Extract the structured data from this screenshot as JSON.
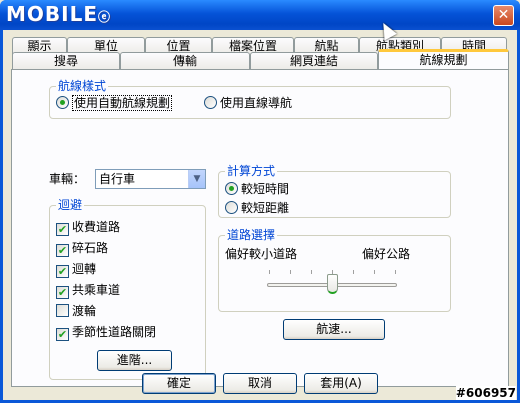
{
  "window": {
    "title_logo": "MOBILE",
    "title_logo_mark": "ⓔ"
  },
  "tabs_row1": [
    "顯示",
    "單位",
    "位置",
    "檔案位置",
    "航點",
    "航點類別",
    "時間"
  ],
  "tabs_row2": [
    "搜尋",
    "傳輸",
    "網頁連結",
    "航線規劃"
  ],
  "routing_style": {
    "title": "航線樣式",
    "options": [
      "使用自動航線規劃",
      "使用直線導航"
    ],
    "selected_index": 0
  },
  "vehicle": {
    "label": "車輛：",
    "value": "自行車"
  },
  "avoid": {
    "title": "迴避",
    "items": [
      {
        "label": "收費道路",
        "checked": true
      },
      {
        "label": "碎石路",
        "checked": true
      },
      {
        "label": "迴轉",
        "checked": true
      },
      {
        "label": "共乘車道",
        "checked": true
      },
      {
        "label": "渡輪",
        "checked": false
      },
      {
        "label": "季節性道路關閉",
        "checked": true
      }
    ],
    "advanced_button": "進階..."
  },
  "calc_method": {
    "title": "計算方式",
    "options": [
      "較短時間",
      "較短距離"
    ],
    "selected_index": 0
  },
  "road_selection": {
    "title": "道路選擇",
    "left_label": "偏好較小道路",
    "right_label": "偏好公路",
    "slider_position": 0.5
  },
  "speed_button": "航速...",
  "footer": {
    "ok": "確定",
    "cancel": "取消",
    "apply": "套用(A)"
  },
  "watermark": "#606957",
  "close_glyph": "✕",
  "check_glyph": "✔",
  "dropdown_glyph": "▼"
}
